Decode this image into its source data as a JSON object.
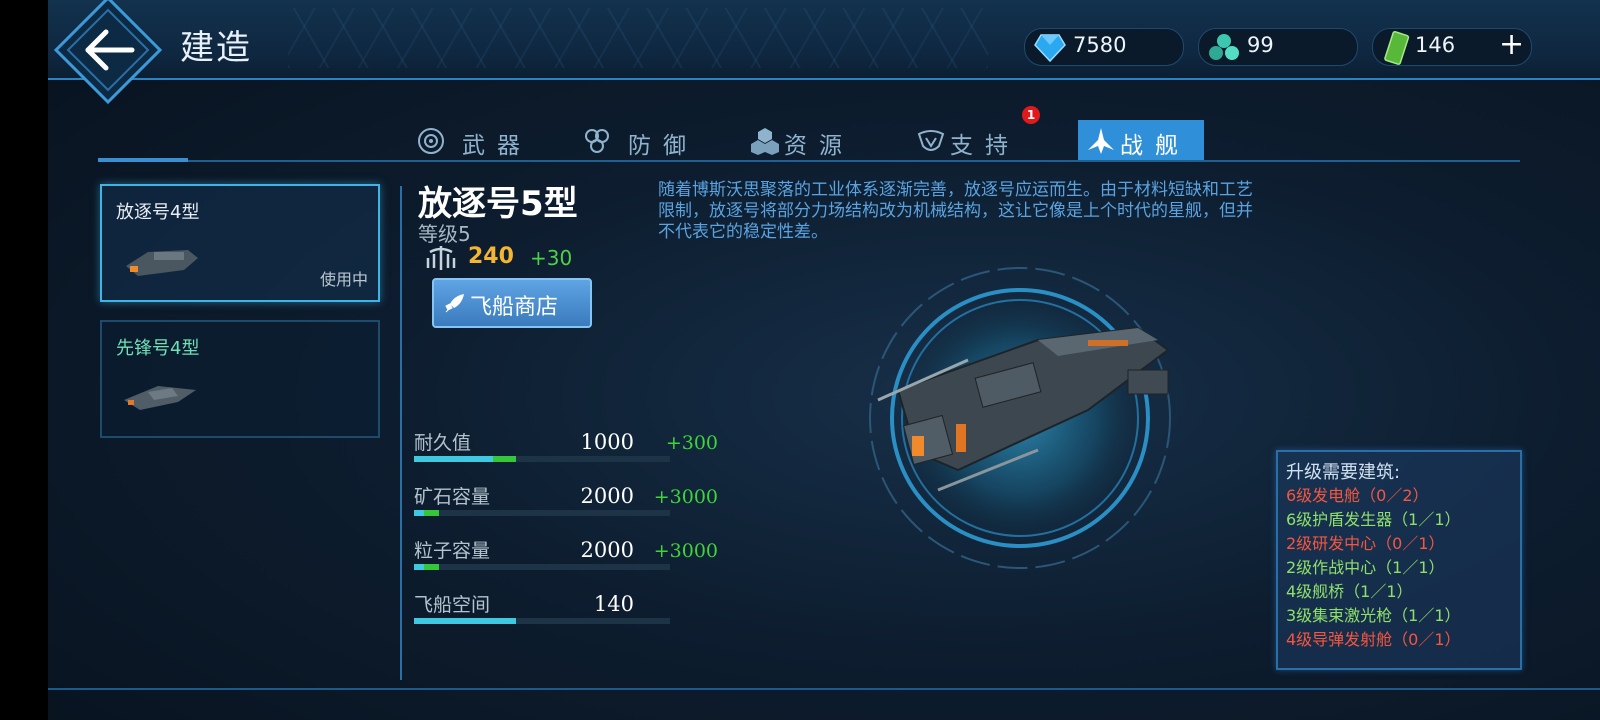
{
  "header": {
    "title": "建造",
    "resources": [
      {
        "icon": "crystal-icon",
        "value": "7580"
      },
      {
        "icon": "particles-icon",
        "value": "99"
      },
      {
        "icon": "cash-icon",
        "value": "146"
      }
    ],
    "add_label": "+"
  },
  "tabs": [
    {
      "label": "武器",
      "icon": "weapon-icon"
    },
    {
      "label": "防御",
      "icon": "defense-icon"
    },
    {
      "label": "资源",
      "icon": "resource-icon"
    },
    {
      "label": "支持",
      "icon": "support-icon"
    },
    {
      "label": "战舰",
      "icon": "battleship-icon",
      "active": true
    }
  ],
  "support_badge": "1",
  "ship_list": [
    {
      "name": "放逐号4型",
      "status": "使用中",
      "name_color": "#e8eef4"
    },
    {
      "name": "先锋号4型",
      "status": "",
      "name_color": "#6fe0b8"
    }
  ],
  "detail": {
    "name": "放逐号5型",
    "level": "等级5",
    "power": "240",
    "power_add": "+30",
    "shop_label": "飞船商店",
    "description": "随着博斯沃思聚落的工业体系逐渐完善，放逐号应运而生。由于材料短缺和工艺限制，放逐号将部分力场结构改为机械结构，这让它像是上个时代的星舰，但并不代表它的稳定性差。",
    "stats": [
      {
        "label": "耐久值",
        "value": "1000",
        "add": "+300",
        "fill": 0.31,
        "up": 0.09
      },
      {
        "label": "矿石容量",
        "value": "2000",
        "add": "+3000",
        "fill": 0.04,
        "up": 0.06
      },
      {
        "label": "粒子容量",
        "value": "2000",
        "add": "+3000",
        "fill": 0.04,
        "up": 0.06
      },
      {
        "label": "飞船空间",
        "value": "140",
        "add": "",
        "fill": 0.4,
        "up": 0
      }
    ]
  },
  "requirements": {
    "title": "升级需要建筑:",
    "items": [
      {
        "text": "6级发电舱（0／2）",
        "met": false
      },
      {
        "text": "6级护盾发生器（1／1）",
        "met": true
      },
      {
        "text": "2级研发中心（0／1）",
        "met": false
      },
      {
        "text": "2级作战中心（1／1）",
        "met": true
      },
      {
        "text": "4级舰桥（1／1）",
        "met": true
      },
      {
        "text": "3级集束激光枪（1／1）",
        "met": true
      },
      {
        "text": "4级导弹发射舱（0／1）",
        "met": false
      }
    ]
  }
}
